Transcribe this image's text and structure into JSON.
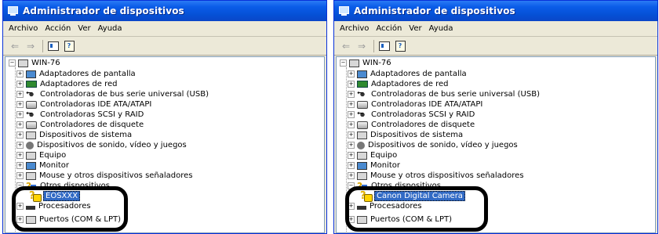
{
  "window_title": "Administrador de dispositivos",
  "menu": [
    {
      "label": "Archivo"
    },
    {
      "label": "Acción"
    },
    {
      "label": "Ver"
    },
    {
      "label": "Ayuda"
    }
  ],
  "toolbar": {
    "back_icon": "back-arrow-icon",
    "forward_icon": "forward-arrow-icon"
  },
  "left": {
    "root": "WIN-76",
    "items": [
      "Adaptadores de pantalla",
      "Adaptadores de red",
      "Controladoras de bus serie universal (USB)",
      "Controladoras IDE ATA/ATAPI",
      "Controladoras SCSI y RAID",
      "Controladores de disquete",
      "Dispositivos de sistema",
      "Dispositivos de sonido, vídeo y juegos",
      "Equipo",
      "Monitor",
      "Mouse y otros dispositivos señaladores",
      "Otros dispositivos",
      "EOSXXX",
      "Procesadores",
      "Puertos (COM & LPT)"
    ]
  },
  "right": {
    "root": "WIN-76",
    "items": [
      "Adaptadores de pantalla",
      "Adaptadores de red",
      "Controladoras de bus serie universal (USB)",
      "Controladoras IDE ATA/ATAPI",
      "Controladoras SCSI y RAID",
      "Controladores de disquete",
      "Dispositivos de sistema",
      "Dispositivos de sonido, vídeo y juegos",
      "Equipo",
      "Monitor",
      "Mouse y otros dispositivos señaladores",
      "Otros dispositivos",
      "Canon Digital Camera",
      "Procesadores",
      "Puertos (COM & LPT)"
    ]
  },
  "colors": {
    "titlebar": "#0a5ce8",
    "selection": "#316ac5",
    "highlight_ring": "#000000"
  }
}
